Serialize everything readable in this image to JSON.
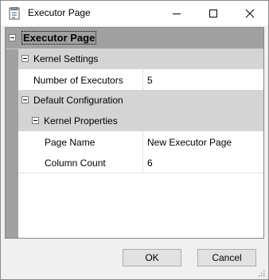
{
  "window": {
    "title": "Executor Page"
  },
  "grid": {
    "root": "Executor Page",
    "kernel_settings": {
      "label": "Kernel Settings",
      "number_of_executors": {
        "name": "Number of Executors",
        "value": "5"
      }
    },
    "default_configuration": {
      "label": "Default Configuration",
      "kernel_properties": {
        "label": "Kernel Properties",
        "page_name": {
          "name": "Page Name",
          "value": "New Executor Page"
        },
        "column_count": {
          "name": "Column Count",
          "value": "6"
        }
      }
    }
  },
  "buttons": {
    "ok": "OK",
    "cancel": "Cancel"
  }
}
